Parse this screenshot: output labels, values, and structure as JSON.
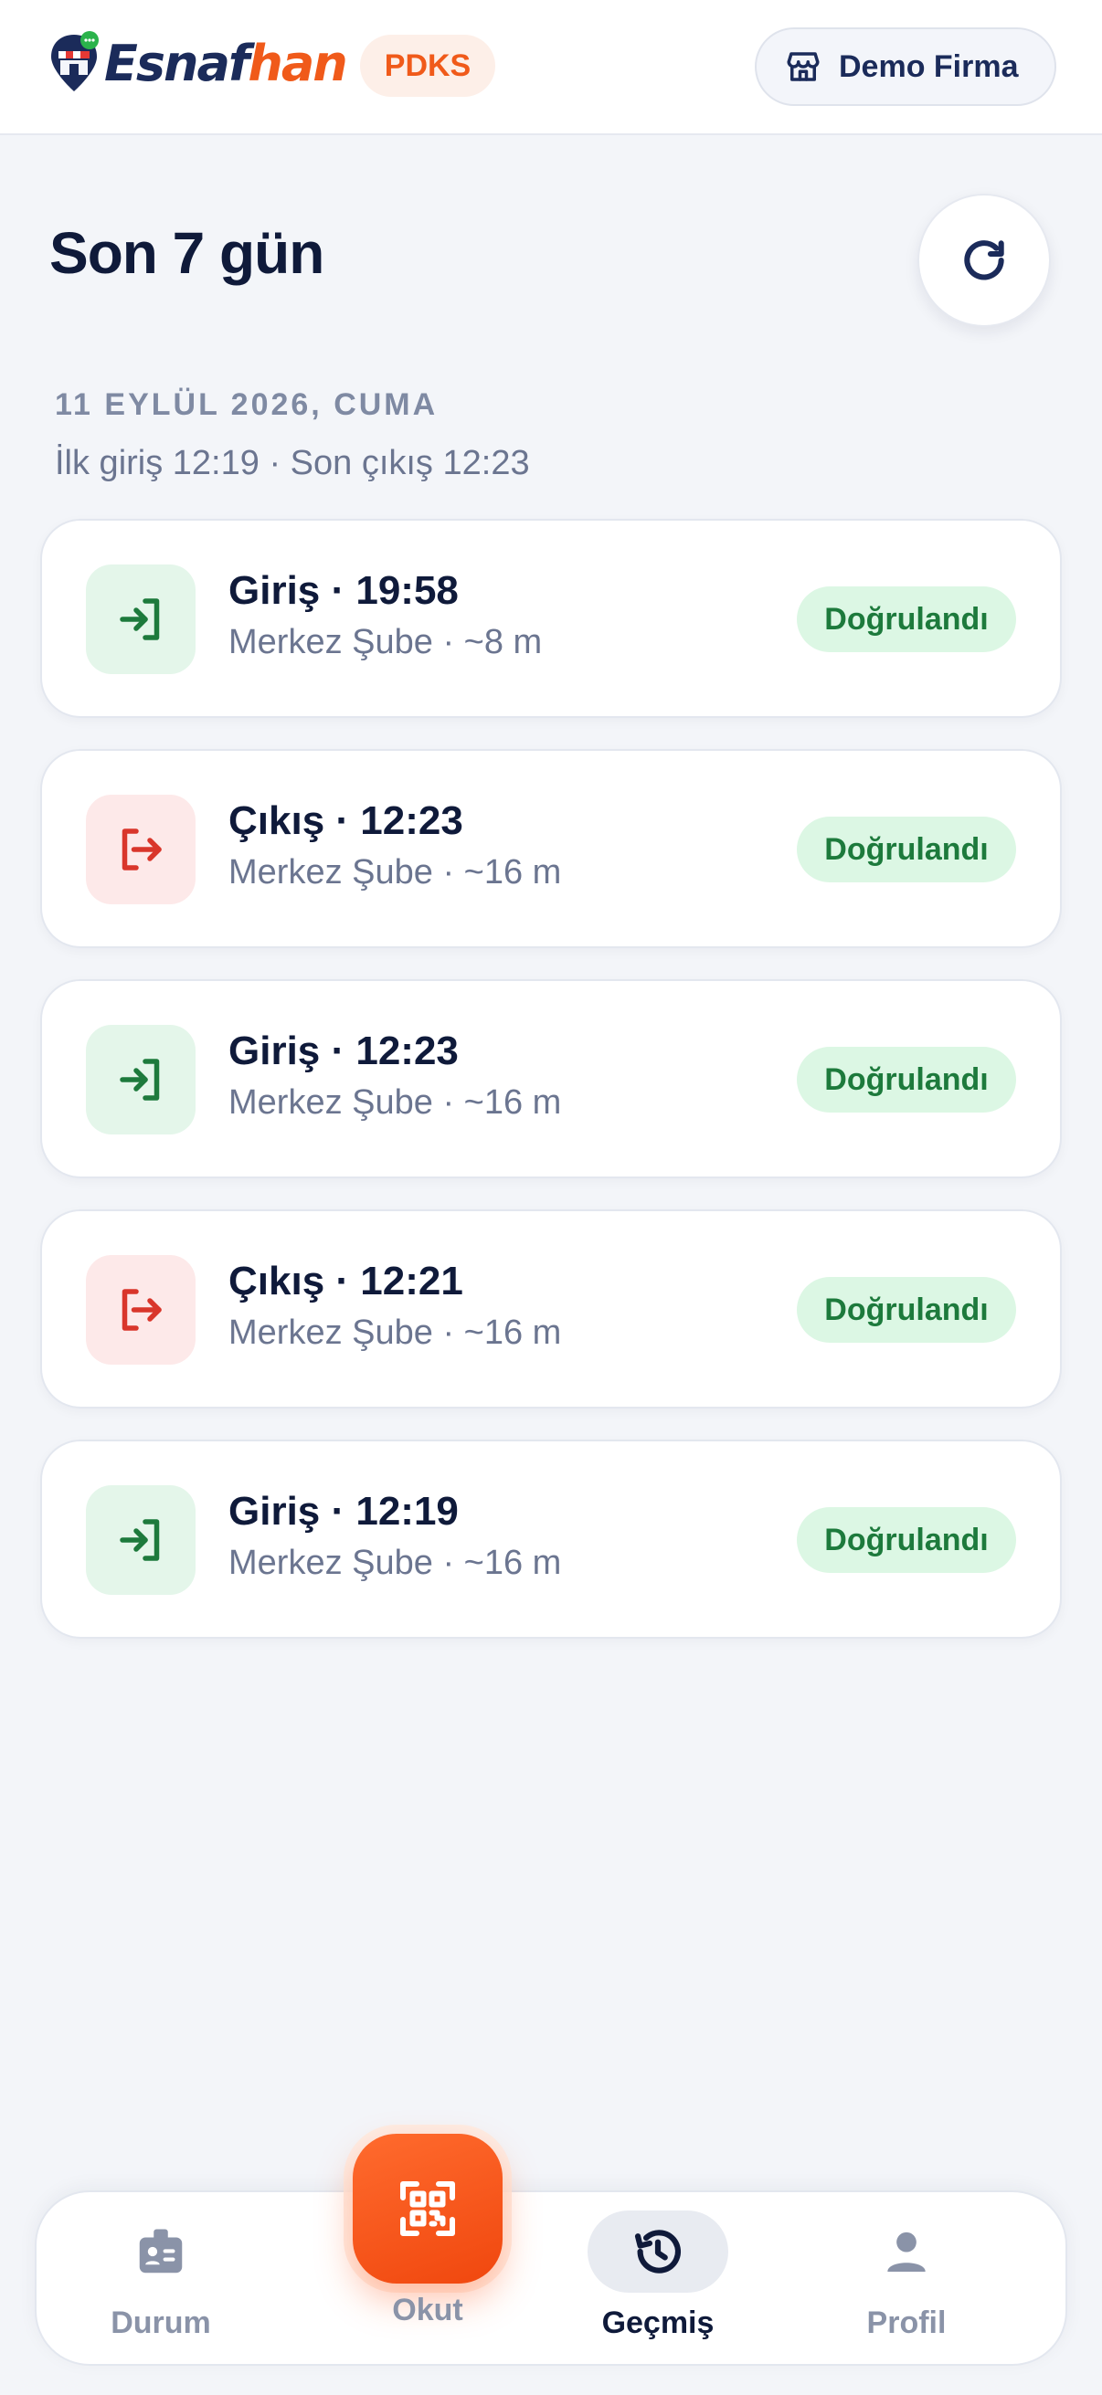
{
  "header": {
    "brand_part1": "Esnaf",
    "brand_part2": "han",
    "badge": "PDKS",
    "company": "Demo Firma"
  },
  "page": {
    "title": "Son 7 gün",
    "day_label": "11 EYLÜL 2026, CUMA",
    "day_summary": "İlk giriş 12:19 · Son çıkış 12:23"
  },
  "records": [
    {
      "type": "in",
      "title": "Giriş · 19:58",
      "subtitle": "Merkez Şube · ~8 m",
      "status": "Doğrulandı"
    },
    {
      "type": "out",
      "title": "Çıkış · 12:23",
      "subtitle": "Merkez Şube · ~16 m",
      "status": "Doğrulandı"
    },
    {
      "type": "in",
      "title": "Giriş · 12:23",
      "subtitle": "Merkez Şube · ~16 m",
      "status": "Doğrulandı"
    },
    {
      "type": "out",
      "title": "Çıkış · 12:21",
      "subtitle": "Merkez Şube · ~16 m",
      "status": "Doğrulandı"
    },
    {
      "type": "in",
      "title": "Giriş · 12:19",
      "subtitle": "Merkez Şube · ~16 m",
      "status": "Doğrulandı"
    }
  ],
  "nav": {
    "durum": "Durum",
    "okut": "Okut",
    "gecmis": "Geçmiş",
    "profil": "Profil"
  },
  "colors": {
    "brand_navy": "#1b2b5a",
    "brand_orange": "#f05a1a",
    "in_green": "#1d7a3c",
    "out_red": "#d9362b",
    "verified_bg": "#dcf7e4"
  },
  "icons": {
    "logo": "esnafhan-logo-icon",
    "company": "store-icon",
    "refresh": "refresh-icon",
    "in": "login-arrow-icon",
    "out": "logout-arrow-icon",
    "durum": "id-badge-icon",
    "okut": "qr-scan-icon",
    "gecmis": "history-icon",
    "profil": "user-icon"
  }
}
